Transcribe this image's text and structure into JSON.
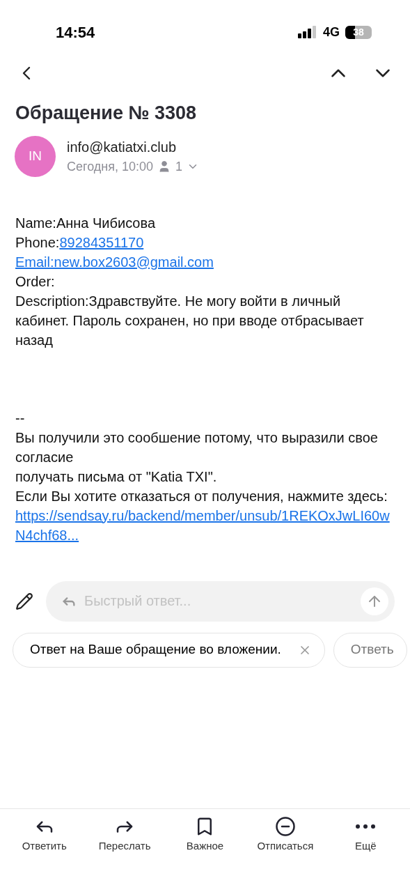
{
  "status_bar": {
    "time": "14:54",
    "network": "4G",
    "battery": "38"
  },
  "subject": "Обращение № 3308",
  "sender": {
    "initials": "IN",
    "color": "#e672c4",
    "address": "info@katiatxi.club",
    "date": "Сегодня, 10:00",
    "recipients": "1"
  },
  "body": [
    {
      "parts": [
        {
          "text": "Name:Анна Чибисова",
          "link": false
        }
      ]
    },
    {
      "parts": [
        {
          "text": "Phone:",
          "link": false
        },
        {
          "text": "89284351170",
          "link": true
        }
      ]
    },
    {
      "parts": [
        {
          "text": "Email:new.box2603@gmail.com",
          "link": true
        }
      ]
    },
    {
      "parts": [
        {
          "text": "Order:",
          "link": false
        }
      ]
    },
    {
      "parts": [
        {
          "text": "Description:Здравствуйте. Не могу войти в личный кабинет. Пароль сохранен, но при вводе отбрасывает назад",
          "link": false
        }
      ]
    }
  ],
  "footer": [
    {
      "parts": [
        {
          "text": "--",
          "link": false
        }
      ]
    },
    {
      "parts": [
        {
          "text": "Вы получили это сообшение потому, что выразили свое согласие",
          "link": false
        }
      ]
    },
    {
      "parts": [
        {
          "text": "получать письма от \"Katia TXI\".",
          "link": false
        }
      ]
    },
    {
      "parts": [
        {
          "text": "Если Вы хотите отказаться от получения, нажмите здесь:",
          "link": false
        }
      ]
    },
    {
      "parts": [
        {
          "text": "https://sendsay.ru/backend/member/unsub/1REKOxJwLI60wN4chf68...",
          "link": true
        }
      ]
    }
  ],
  "quick_reply": {
    "placeholder": "Быстрый ответ..."
  },
  "suggestions": [
    {
      "label": "Ответ на Ваше обращение во вложении.",
      "dismissible": true
    },
    {
      "label": "Ответь",
      "dismissible": false
    }
  ],
  "toolbar": [
    {
      "kind": "reply",
      "label": "Ответить"
    },
    {
      "kind": "forward",
      "label": "Переслать"
    },
    {
      "kind": "bookmark",
      "label": "Важное"
    },
    {
      "kind": "unsubscribe",
      "label": "Отписаться"
    },
    {
      "kind": "more",
      "label": "Ещё"
    }
  ]
}
